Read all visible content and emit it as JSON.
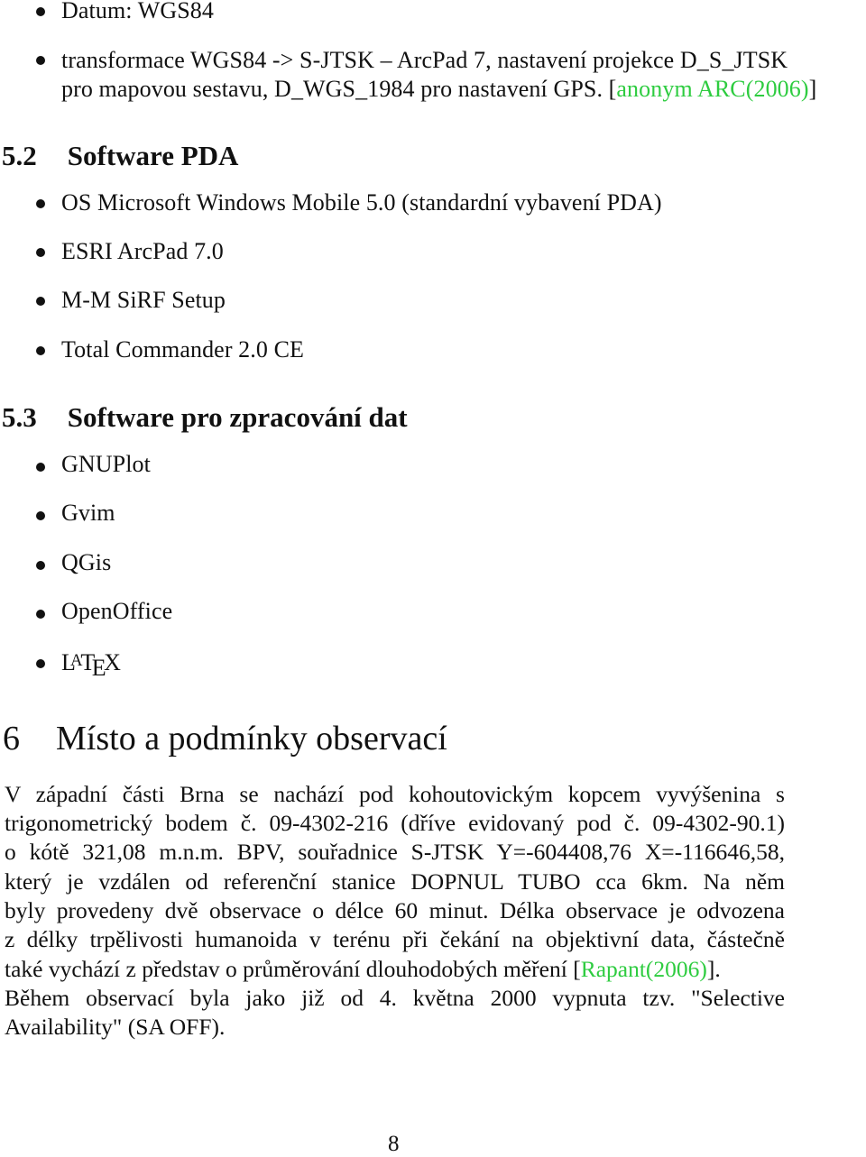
{
  "top_list": [
    {
      "text": "Datum: WGS84"
    },
    {
      "line1": "transformace WGS84 -> S-JTSK – ArcPad 7, nastavení projekce D_S_JTSK",
      "line2": "pro mapovou sestavu, D_WGS_1984 pro nastavení GPS. [",
      "cite": "anonym ARC(2006)",
      "after": "]"
    }
  ],
  "section_5_2": {
    "number": "5.2",
    "title": "Software PDA",
    "items": [
      "OS Microsoft Windows Mobile 5.0 (standardní vybavení PDA)",
      "ESRI ArcPad 7.0",
      "M-M SiRF Setup",
      "Total Commander 2.0 CE"
    ]
  },
  "section_5_3": {
    "number": "5.3",
    "title": "Software pro zpracování dat",
    "items": [
      "GNUPlot",
      "Gvim",
      "QGis",
      "OpenOffice"
    ],
    "latex": {
      "l": "L",
      "a": "A",
      "t": "T",
      "e": "E",
      "x": "X"
    }
  },
  "section_6": {
    "number": "6",
    "title": "Místo a podmínky observací",
    "paragraph_lines": [
      "V západní části Brna se nachází pod kohoutovickým kopcem vyvýšenina s",
      "trigonometrický bodem č. 09-4302-216 (dříve evidovaný pod č. 09-4302-90.1)",
      "o kótě 321,08 m.n.m. BPV, souřadnice S-JTSK Y=-604408,76 X=-116646,58,",
      "který je vzdálen od referenční stanice DOPNUL TUBO cca 6km. Na něm",
      "byly provedeny dvě observace o délce 60 minut. Délka observace je odvozena",
      "z délky trpělivosti humanoida v terénu při čekání na objektivní data, částečně"
    ],
    "cite_line": {
      "before": "také vychází z představ o průměrování dlouhodobých měření [",
      "cite": "Rapant(2006)",
      "after": "]."
    },
    "line_9": "Během observací byla jako již od 4. května 2000 vypnuta tzv. \"Selective",
    "line_10": "Availability\" (SA OFF)."
  },
  "page_number": "8",
  "colors": {
    "citation": "#2ecc40",
    "text": "#111111"
  }
}
